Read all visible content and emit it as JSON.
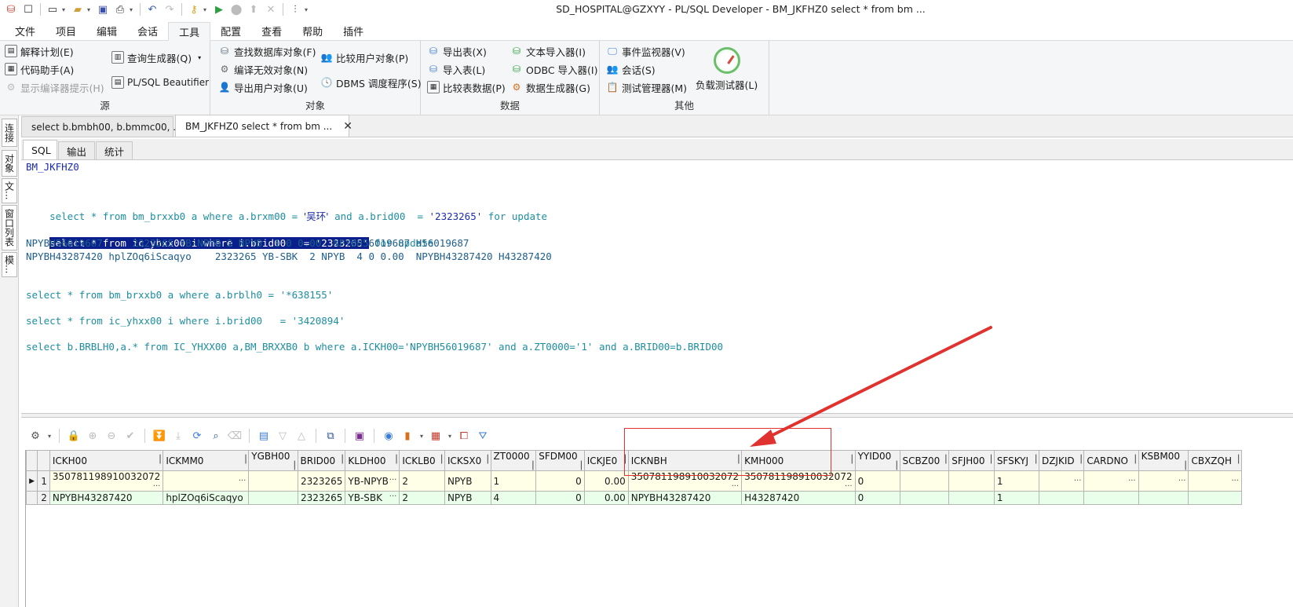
{
  "title": "SD_HOSPITAL@GZXYY - PL/SQL Developer - BM_JKFHZ0 select * from bm ...",
  "menu": [
    "文件",
    "项目",
    "编辑",
    "会话",
    "工具",
    "配置",
    "查看",
    "帮助",
    "插件"
  ],
  "ribbon": {
    "source": {
      "label": "源",
      "items": [
        "解释计划(E)",
        "代码助手(A)",
        "显示编译器提示(H)",
        "查询生成器(Q)",
        "PL/SQL Beautifier"
      ]
    },
    "objects": {
      "label": "对象",
      "items": [
        "查找数据库对象(F)",
        "编译无效对象(N)",
        "导出用户对象(U)",
        "比较用户对象(P)",
        "DBMS 调度程序(S)"
      ]
    },
    "data": {
      "label": "数据",
      "items": [
        "导出表(X)",
        "导入表(L)",
        "比较表数据(P)",
        "文本导入器(I)",
        "ODBC 导入器(I)",
        "数据生成器(G)"
      ]
    },
    "other": {
      "label": "其他",
      "items": [
        "事件监视器(V)",
        "会话(S)",
        "测试管理器(M)",
        "负载测试器(L)"
      ]
    }
  },
  "left_tabs": [
    "连接",
    "对象",
    "文...",
    "窗口列表",
    "模..."
  ],
  "doc_tabs": [
    "select b.bmbh00, b.bmmc00, ...",
    "BM_JKFHZ0 select * from bm ..."
  ],
  "inner_tabs": [
    "SQL",
    "输出",
    "统计"
  ],
  "editor": {
    "l1": "BM_JKFHZ0",
    "l2a": "select * from bm_brxxb0 a where a.brxm00 = ",
    "l2b": "'吴环'",
    "l2c": " and a.brid00  = ",
    "l2d": "'2323265'",
    "l2e": " for update",
    "l3a": "select * from ic_yhxx00 i where i.brid00   = '2323265'",
    "l3b": " for update",
    "l4": "NPYBH56019687     2323265 YB-NPYB 2 NPYB  1 0 0.00  NPYBH56019687 H56019687",
    "l5": "NPYBH43287420 hplZOq6iScaqyo    2323265 YB-SBK  2 NPYB  4 0 0.00  NPYBH43287420 H43287420",
    "l6": "select * from bm_brxxb0 a where a.brblh0 = '*638155'",
    "l7": "select * from ic_yhxx00 i where i.brid00   = '3420894'",
    "l8": "select b.BRBLH0,a.* from IC_YHXX00 a,BM_BRXXB0 b where a.ICKH00='NPYBH56019687' and a.ZT0000='1' and a.BRID00=b.BRID00"
  },
  "grid": {
    "columns": [
      "ICKH00",
      "ICKMM0",
      "YGBH00",
      "BRID00",
      "KLDH00",
      "ICKLB0",
      "ICKSX0",
      "ZT0000",
      "SFDM00",
      "ICKJE0",
      "ICKNBH",
      "KMH000",
      "YYID00",
      "SCBZ00",
      "SFJH00",
      "SFSKYJ",
      "DZJKID",
      "CARDNO",
      "KSBM00",
      "CBXZQH"
    ],
    "rows": [
      [
        "350781198910032072",
        "",
        "",
        "2323265",
        "YB-NPYB",
        "2",
        "NPYB",
        "1",
        "0",
        "0.00",
        "350781198910032072",
        "350781198910032072",
        "0",
        "",
        "",
        "1",
        "",
        "",
        "",
        ""
      ],
      [
        "NPYBH43287420",
        "hplZOq6iScaqyo",
        "",
        "2323265",
        "YB-SBK",
        "2",
        "NPYB",
        "4",
        "0",
        "0.00",
        "NPYBH43287420",
        "H43287420",
        "0",
        "",
        "",
        "1",
        "",
        "",
        "",
        ""
      ]
    ]
  },
  "colors": {
    "highlight": "#0a1e8c",
    "annotation": "#e0332f",
    "row1": "#ffffe8",
    "row2": "#eaffea"
  }
}
